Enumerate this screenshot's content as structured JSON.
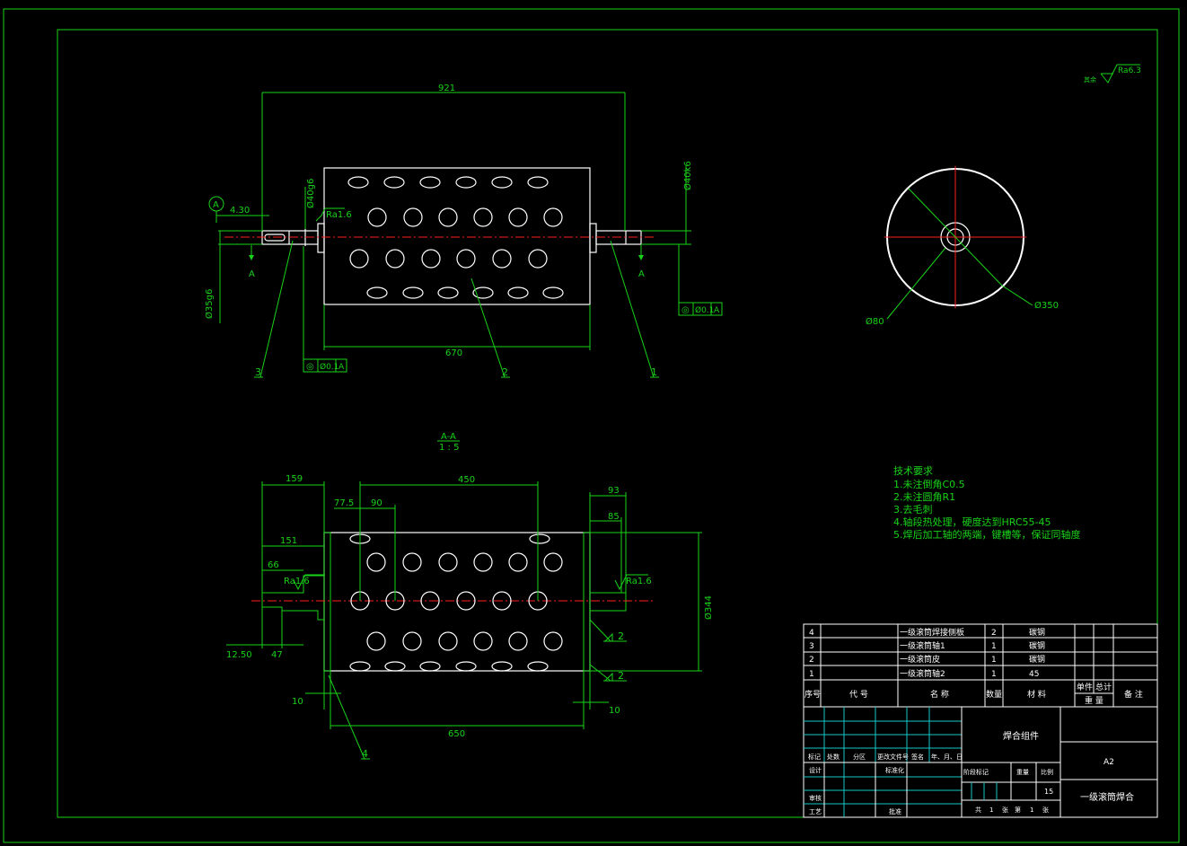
{
  "drawing": {
    "roughness_note": {
      "prefix": "其余",
      "value": "Ra6.3"
    },
    "front_view": {
      "dims": {
        "overall": "921",
        "drum_length": "670",
        "shaft_end": "4.30",
        "shaft_left_dia": "Ø40g6",
        "shaft_right_dia": "Ø40k6",
        "shaft_end_dia": "Ø35g6",
        "roughness": "Ra1.6"
      },
      "datum": "A",
      "section_marks": [
        "A",
        "A"
      ],
      "tolerance_left": {
        "symbol": "◎",
        "value": "Ø0.1",
        "datum": "A"
      },
      "tolerance_right": {
        "symbol": "◎",
        "value": "Ø0.1",
        "datum": "A"
      },
      "balloons": [
        "3",
        "2",
        "1"
      ]
    },
    "side_view": {
      "dims": {
        "outer": "Ø350",
        "inner": "Ø80"
      }
    },
    "section_view": {
      "title": "A-A",
      "scale": "1 : 5",
      "dims": {
        "d159": "159",
        "d151": "151",
        "d66": "66",
        "d77_5": "77.5",
        "d90": "90",
        "d450": "450",
        "d93": "93",
        "d85": "85",
        "d344": "Ø344",
        "d12_50": "12.50",
        "d47": "47",
        "d10_left": "10",
        "d10_right": "10",
        "d650": "650",
        "roughness_left": "Ra1.6",
        "roughness_right": "Ra1.6",
        "weld_a": "2",
        "weld_b": "2"
      },
      "balloon": "4"
    },
    "tech_requirements": {
      "title": "技术要求",
      "items": [
        "1.未注倒角C0.5",
        "2.未注圆角R1",
        "3.去毛刺",
        "4.轴段热处理，硬度达到HRC55-45",
        "5.焊后加工轴的两端，键槽等，保证同轴度"
      ]
    },
    "bom": {
      "rows": [
        {
          "no": "4",
          "name": "一级滚筒焊接侧板",
          "qty": "2",
          "material": "碳钢"
        },
        {
          "no": "3",
          "name": "一级滚筒轴1",
          "qty": "1",
          "material": "碳钢"
        },
        {
          "no": "2",
          "name": "一级滚筒皮",
          "qty": "1",
          "material": "碳钢"
        },
        {
          "no": "1",
          "name": "一级滚筒轴2",
          "qty": "1",
          "material": "45"
        }
      ],
      "headers": {
        "no": "序号",
        "code": "代 号",
        "name": "名 称",
        "qty": "数量",
        "material": "材 料",
        "unit": "单件",
        "total": "总计",
        "weight": "重 量",
        "remark": "备 注"
      }
    },
    "title_block": {
      "assembly": "焊合组件",
      "sheet_size": "A2",
      "drawing_name": "一级滚筒焊合",
      "rev_headers": [
        "标记",
        "处数",
        "分区",
        "更改文件号",
        "签名",
        "年、月、日"
      ],
      "design": "设计",
      "standard": "标准化",
      "review": "审核",
      "process": "工艺",
      "approve": "批准",
      "stage_mark": "阶段标记",
      "weight": "重量",
      "scale_label": "比例",
      "scale": "15",
      "total_sheets_label": "共",
      "total_sheets": "1",
      "sheet_unit": "张",
      "sheet_no_label": "第",
      "sheet_no": "1",
      "sheet_no_unit": "张"
    }
  }
}
